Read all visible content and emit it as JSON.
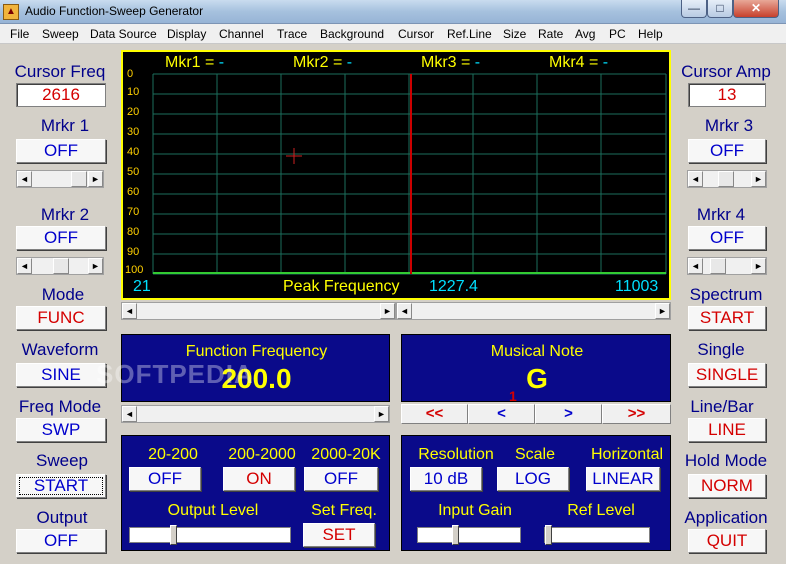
{
  "window": {
    "title": "Audio Function-Sweep Generator",
    "min": "—",
    "max": "□",
    "close": "✕"
  },
  "menu": [
    "File",
    "Sweep",
    "Data Source",
    "Display",
    "Channel",
    "Trace",
    "Background",
    "Cursor",
    "Ref.Line",
    "Size",
    "Rate",
    "Avg",
    "PC",
    "Help"
  ],
  "left": {
    "cursor_freq_label": "Cursor Freq",
    "cursor_freq_value": "2616",
    "mrkr1_label": "Mrkr 1",
    "mrkr1_btn": "OFF",
    "mrkr2_label": "Mrkr 2",
    "mrkr2_btn": "OFF",
    "mode_label": "Mode",
    "mode_btn": "FUNC",
    "waveform_label": "Waveform",
    "waveform_btn": "SINE",
    "freqmode_label": "Freq Mode",
    "freqmode_btn": "SWP",
    "sweep_label": "Sweep",
    "sweep_btn": "START",
    "output_label": "Output",
    "output_btn": "OFF"
  },
  "right": {
    "cursor_amp_label": "Cursor Amp",
    "cursor_amp_value": "13",
    "mrkr3_label": "Mrkr 3",
    "mrkr3_btn": "OFF",
    "mrkr4_label": "Mrkr 4",
    "mrkr4_btn": "OFF",
    "spectrum_label": "Spectrum",
    "spectrum_btn": "START",
    "single_label": "Single",
    "single_btn": "SINGLE",
    "linebar_label": "Line/Bar",
    "linebar_btn": "LINE",
    "hold_label": "Hold Mode",
    "hold_btn": "NORM",
    "app_label": "Application",
    "app_btn": "QUIT"
  },
  "display": {
    "markers": [
      {
        "label": "Mkr1 = ",
        "value": "-"
      },
      {
        "label": "Mkr2 = ",
        "value": "-"
      },
      {
        "label": "Mkr3 = ",
        "value": "-"
      },
      {
        "label": "Mkr4 = ",
        "value": "-"
      }
    ],
    "y_labels": [
      "0",
      "10",
      "20",
      "30",
      "40",
      "50",
      "60",
      "70",
      "80",
      "90",
      "100"
    ],
    "x_start": "21",
    "x_end": "11003",
    "peak_label": "Peak Frequency",
    "peak_value": "1227.4",
    "cursor_line_color": "#cc0000",
    "grid_color": "#1c6e5c",
    "bg_color": "#000000"
  },
  "function": {
    "title": "Function Frequency",
    "value": "200.0"
  },
  "note": {
    "title": "Musical Note",
    "value": "G",
    "nav": [
      "<<",
      "<",
      ">",
      ">>"
    ],
    "marker": "1"
  },
  "range": {
    "labels": [
      "20-200",
      "200-2000",
      "2000-20K"
    ],
    "buttons": [
      "OFF",
      "ON",
      "OFF"
    ],
    "output_level": "Output Level",
    "setfreq_label": "Set Freq.",
    "setfreq_btn": "SET"
  },
  "analysis": {
    "res_label": "Resolution",
    "res_btn": "10 dB",
    "scale_label": "Scale",
    "scale_btn": "LOG",
    "horiz_label": "Horizontal",
    "horiz_btn": "LINEAR",
    "input_gain": "Input Gain",
    "ref_level": "Ref Level"
  },
  "watermark": "SOFTPEDIA"
}
